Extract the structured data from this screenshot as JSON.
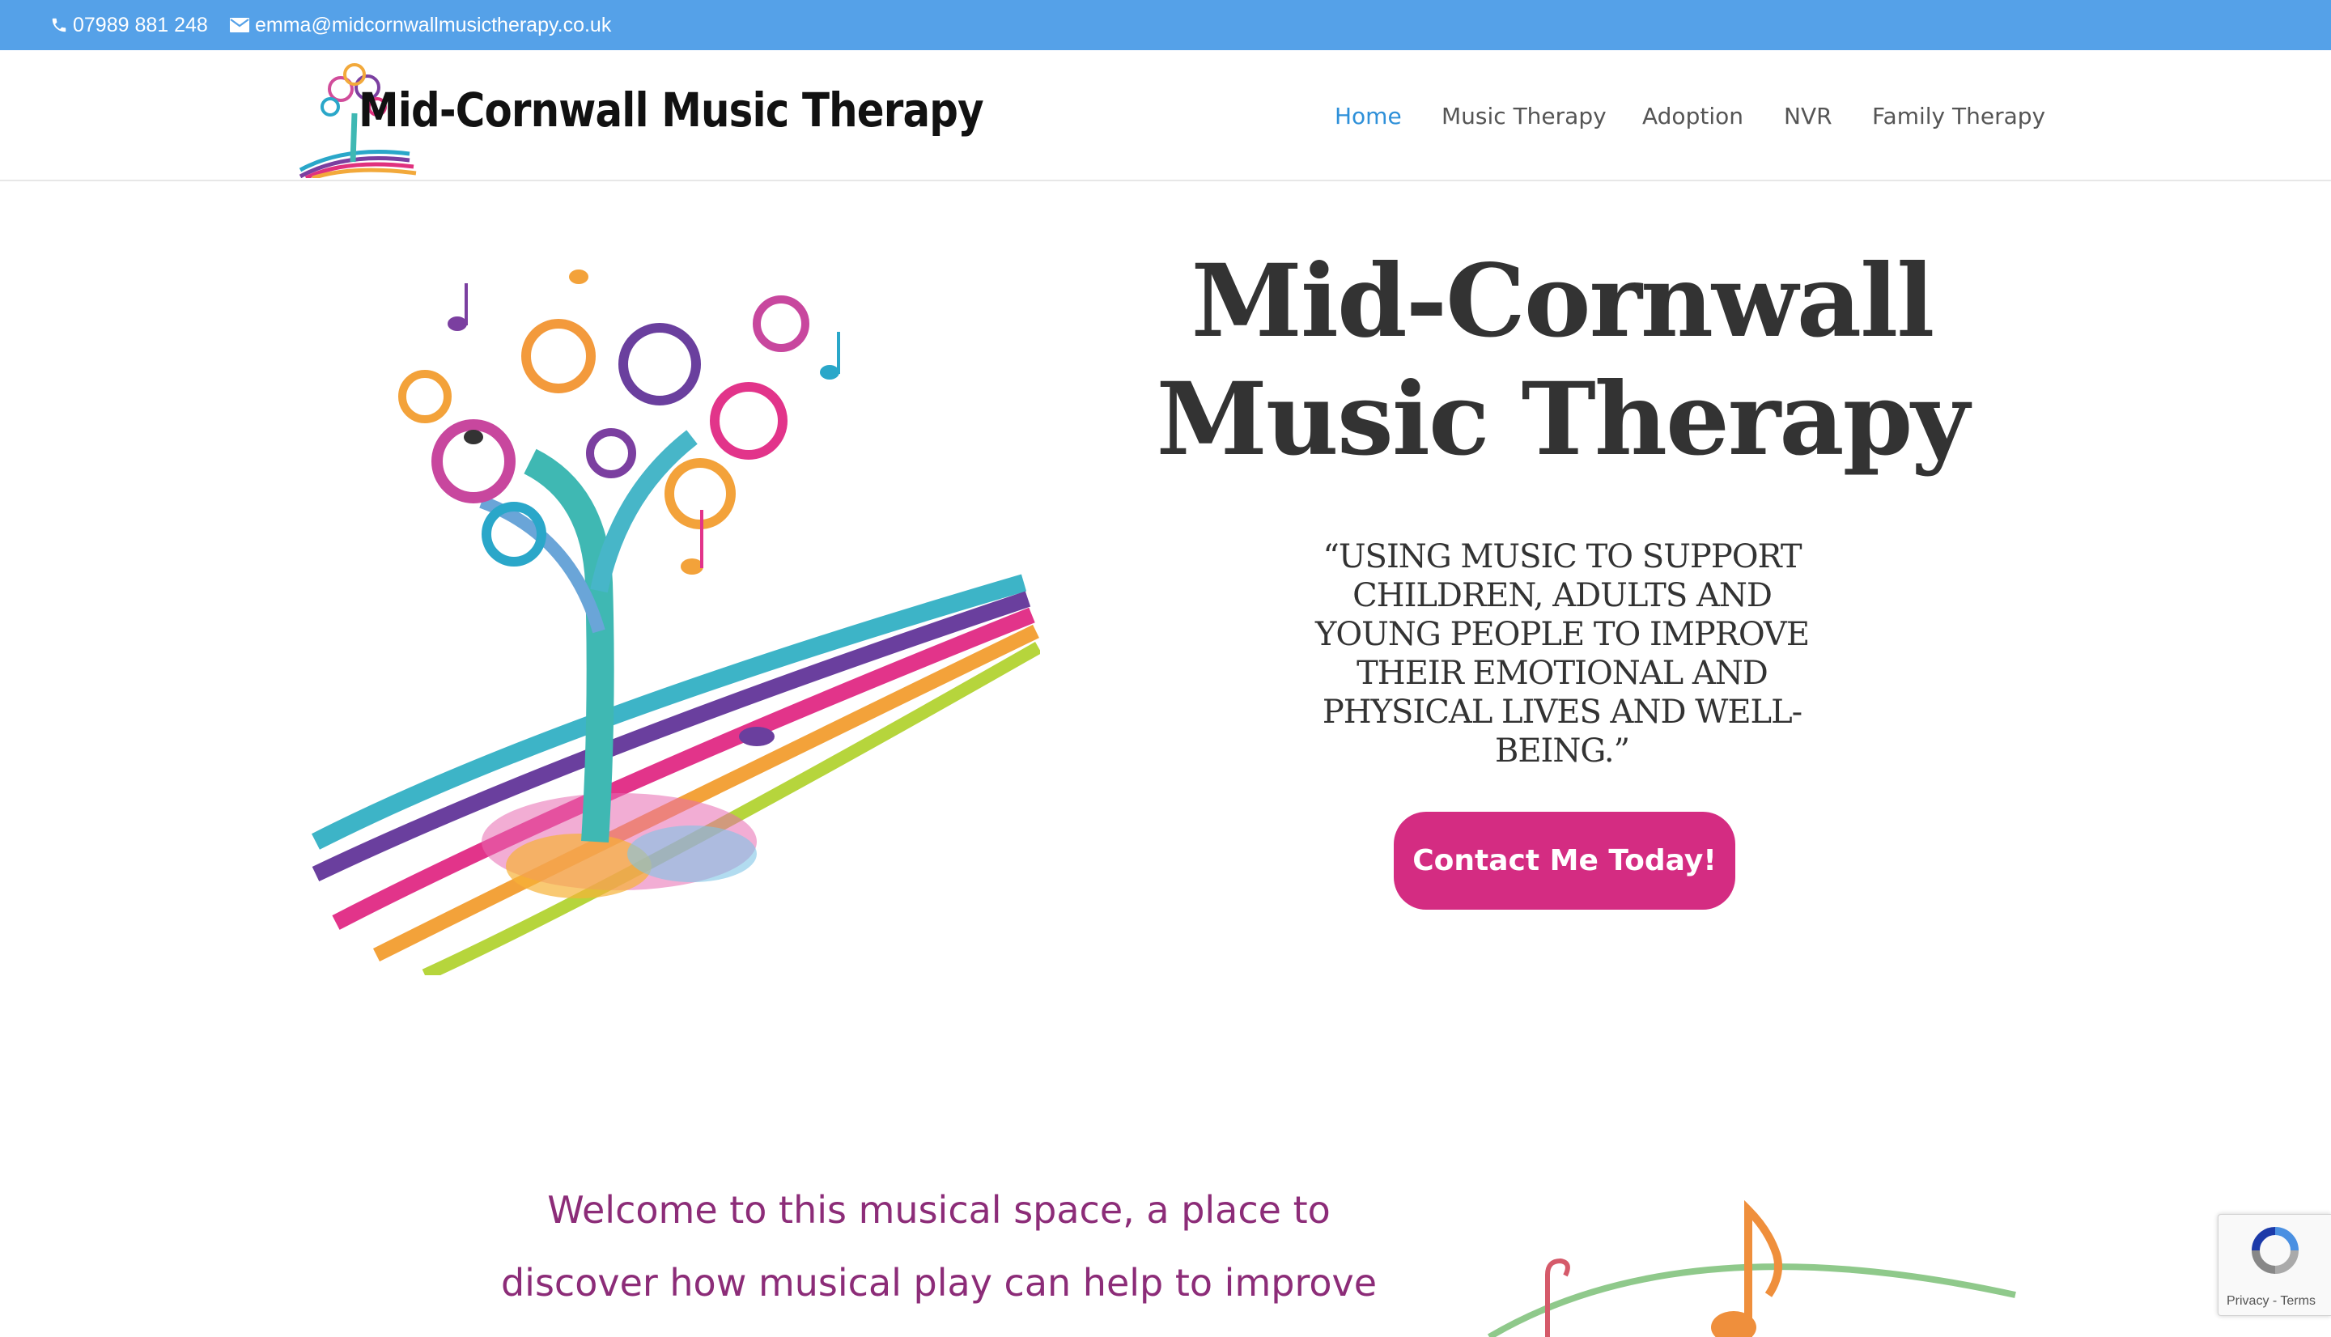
{
  "topbar": {
    "phone": "07989 881 248",
    "email": "emma@midcornwallmusictherapy.co.uk",
    "icons": [
      "phone-icon",
      "envelope-icon"
    ],
    "bg_color": "#55a1e8"
  },
  "header": {
    "logo_text": "Mid-Cornwall Music Therapy",
    "nav": [
      {
        "label": "Home",
        "active": true
      },
      {
        "label": "Music Therapy",
        "active": false
      },
      {
        "label": "Adoption",
        "active": false
      },
      {
        "label": "NVR",
        "active": false
      },
      {
        "label": "Family Therapy",
        "active": false
      }
    ],
    "active_color": "#2e90d9"
  },
  "hero": {
    "title_line1": "Mid-Cornwall",
    "title_line2": "Music Therapy",
    "quote_lines": [
      "“Using music to support",
      "children, adults and",
      "young people to improve",
      "their emotional and",
      "physical lives and well-",
      "being.”"
    ],
    "cta_label": "Contact Me Today!",
    "cta_color": "#d42c82"
  },
  "welcome": {
    "line1": "Welcome to this musical space, a place to",
    "line2": "discover how musical play can help to improve",
    "color": "#8c2c78"
  },
  "recaptcha": {
    "links": "Privacy - Terms"
  }
}
